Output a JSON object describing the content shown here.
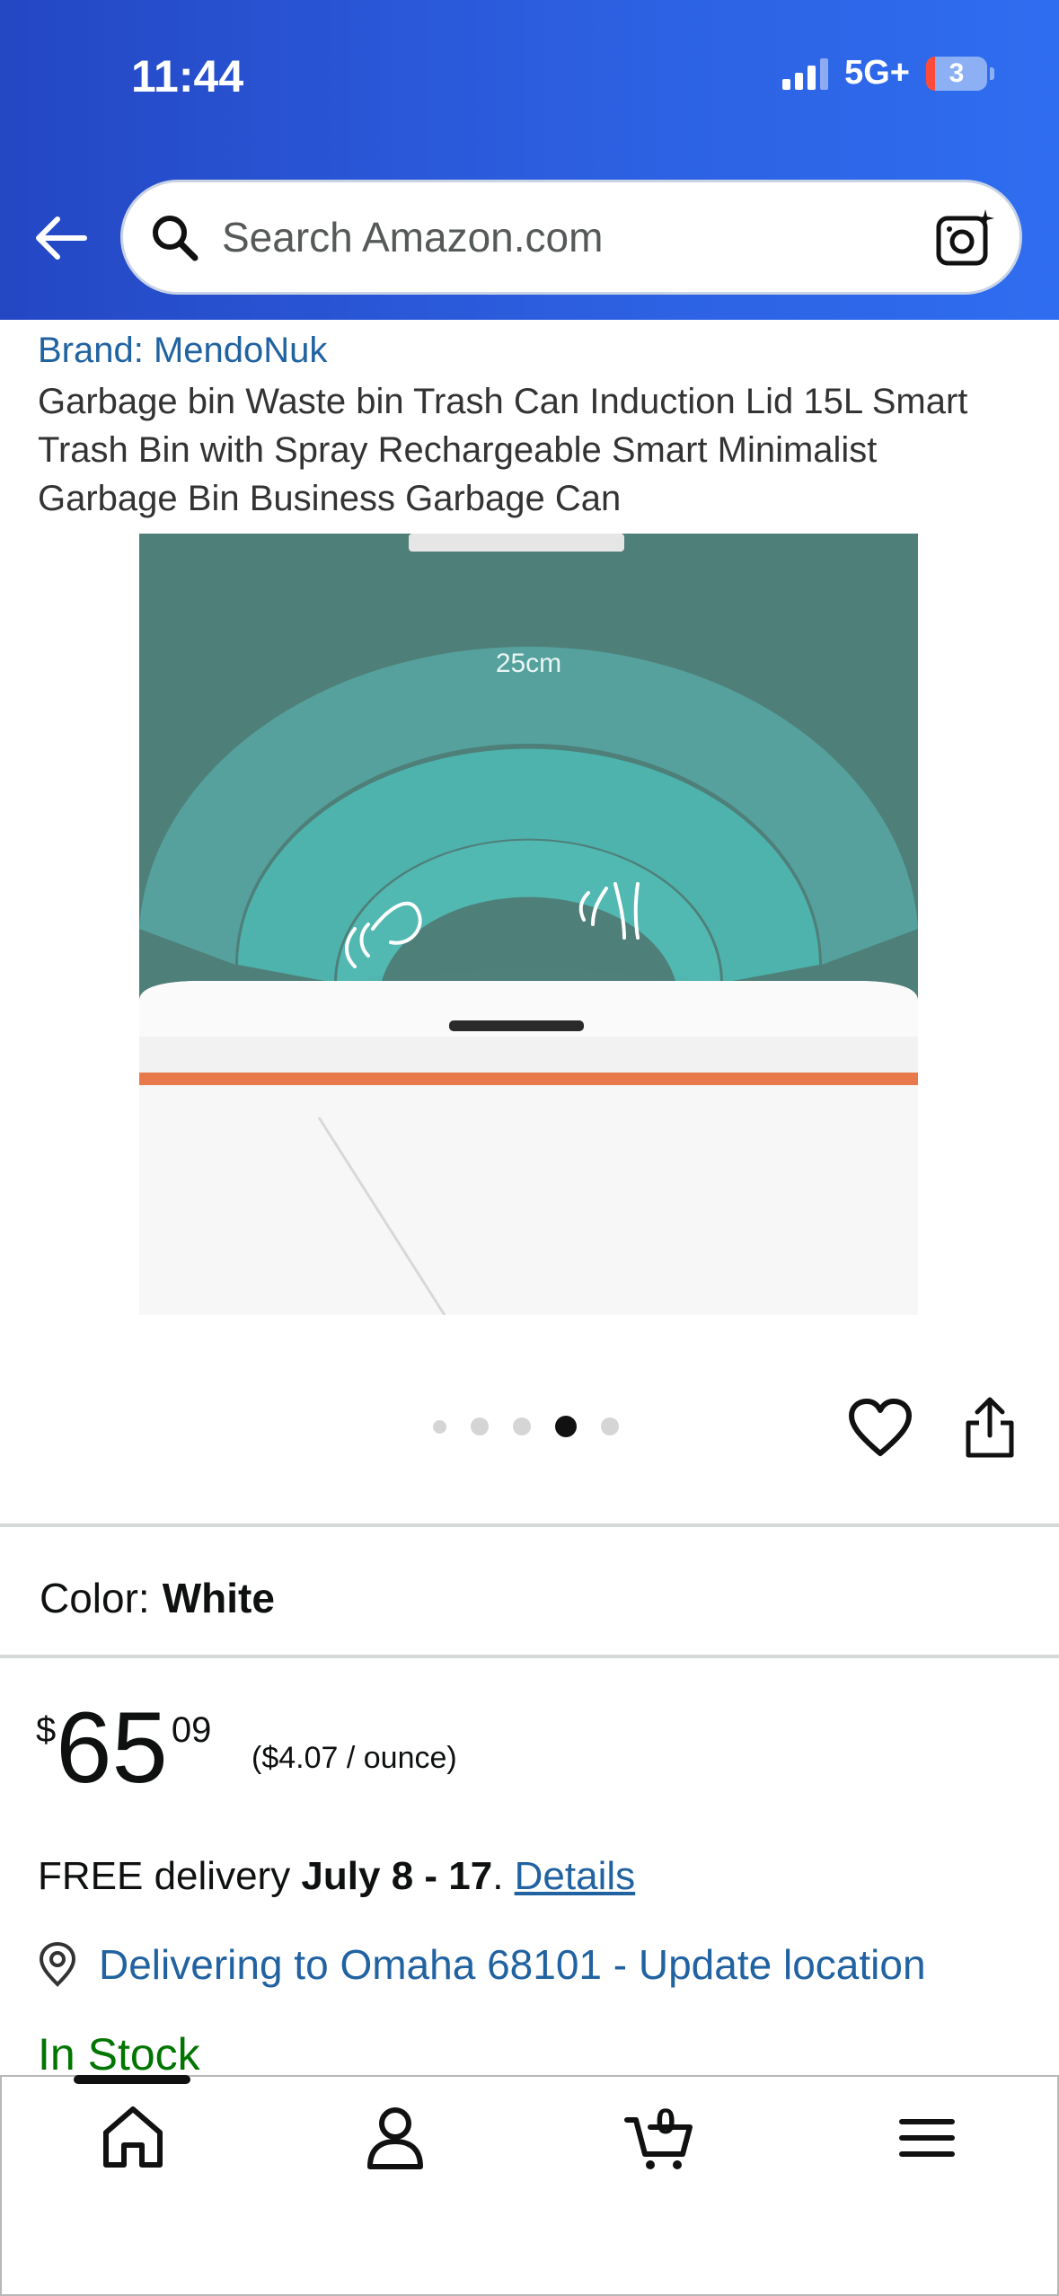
{
  "status_bar": {
    "time": "11:44",
    "network": "5G+",
    "battery": "3"
  },
  "search": {
    "placeholder": "Search Amazon.com"
  },
  "product": {
    "brand": "Brand: MendoNuk",
    "title": "Garbage bin Waste bin Trash Can Induction Lid 15L Smart Trash Bin with Spray Rechargeable Smart Minimalist Garbage Bin Business Garbage Can",
    "image_label": "25cm",
    "image_count": 5,
    "image_active_index": 4
  },
  "color": {
    "label": "Color:",
    "value": "White"
  },
  "price": {
    "symbol": "$",
    "whole": "65",
    "fraction": "09",
    "unit_price": "($4.07 / ounce)"
  },
  "delivery": {
    "prefix": "FREE delivery ",
    "date": "July 8 - 17",
    "period": ". ",
    "details_link": "Details"
  },
  "location": {
    "text": "Delivering to Omaha 68101 - Update location"
  },
  "stock": {
    "text": "In Stock"
  },
  "tabbar": {
    "cart_count": "0",
    "items": [
      "home-icon",
      "profile-icon",
      "cart-icon",
      "menu-icon"
    ]
  },
  "colors": {
    "header_blue": "#2c5fe0",
    "link_blue": "#2162a1",
    "stock_green": "#007600",
    "image_bg": "#4f7f79",
    "accent_orange": "#e8794a"
  }
}
